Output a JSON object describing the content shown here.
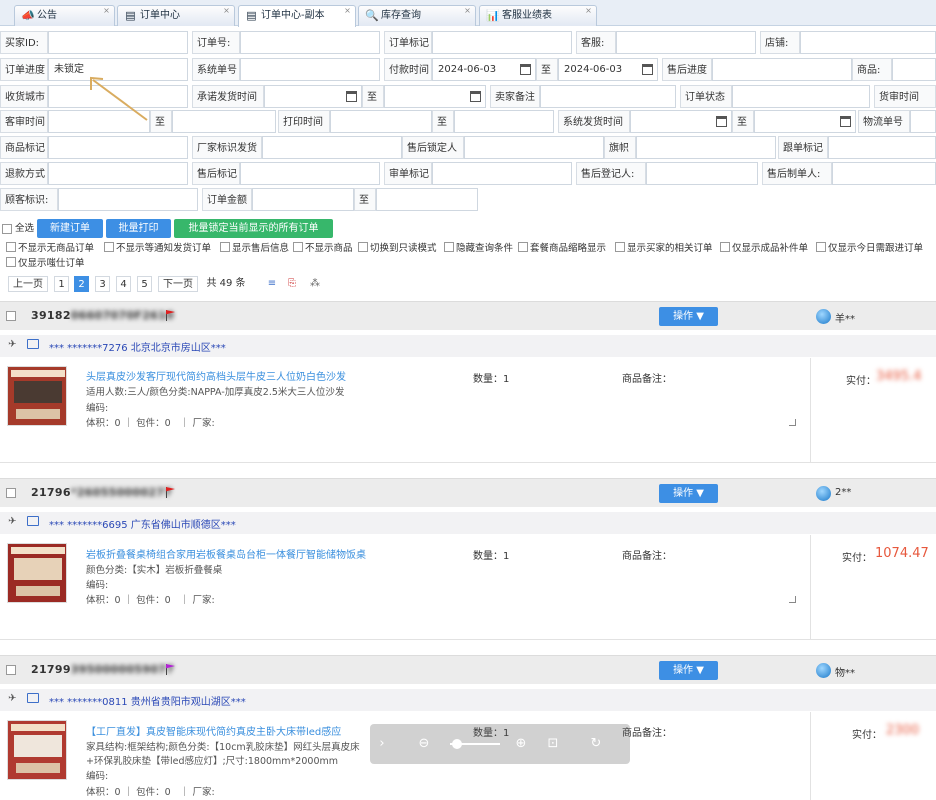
{
  "tabs": [
    {
      "label": "公告",
      "icon": "bullhorn-icon",
      "glyph": "📣"
    },
    {
      "label": "订单中心",
      "icon": "order-icon",
      "glyph": "▤"
    },
    {
      "label": "订单中心-副本",
      "icon": "order-icon",
      "glyph": "▤"
    },
    {
      "label": "库存查询",
      "icon": "search-icon",
      "glyph": "🔍"
    },
    {
      "label": "客服业绩表",
      "icon": "chart-icon",
      "glyph": "📊"
    }
  ],
  "filters": {
    "buyer_id": "买家ID:",
    "order_no": "订单号:",
    "order_tag": "订单标记",
    "cs": "客服:",
    "shop": "店铺:",
    "progress": "订单进度",
    "progress_value": "未锁定",
    "sys_no": "系统单号",
    "pay_time": "付款时间",
    "pay_from": "2024-06-03",
    "to": "至",
    "pay_to": "2024-06-03",
    "after_progress": "售后进度",
    "goods": "商品:",
    "recv_city": "收货城市",
    "promise_time": "承诺发货时间",
    "seller_note": "卖家备注",
    "order_state": "订单状态",
    "stock_time": "货审时间",
    "audit_time": "客审时间",
    "print_time": "打印时间",
    "ship_time": "系统发货时间",
    "logistics_no": "物流单号",
    "goods_tag": "商品标记",
    "factory_tag": "厂家标识发货",
    "after_lock": "售后锁定人",
    "flag": "旗帜",
    "follow_tag": "跟单标记",
    "refund_way": "退款方式",
    "after_tag": "售后标记",
    "audit_tag": "审单标记",
    "after_reg": "售后登记人:",
    "after_maker": "售后制单人:",
    "customer_tag": "顾客标识:",
    "order_amount": "订单金额"
  },
  "actions": {
    "select_all": "全选",
    "new_order": "新建订单",
    "batch_print": "批量打印",
    "batch_lock": "批量锁定当前显示的所有订单"
  },
  "options": [
    "不显示无商品订单",
    "不显示等通知发货订单",
    "显示售后信息",
    "不显示商品",
    "切换到只读模式",
    "隐藏查询条件",
    "套餐商品缩略显示",
    "显示买家的相关订单",
    "仅显示成品补件单",
    "仅显示今日需跟进订单",
    "仅显示嗤仕订单"
  ],
  "pager": {
    "prev": "上一页",
    "pages": [
      "1",
      "2",
      "3",
      "4",
      "5"
    ],
    "current": "2",
    "next": "下一页",
    "total": "共 49 条"
  },
  "orders": [
    {
      "id": "39182",
      "id_tail": "06607070F2610",
      "flag_color": "#e02020",
      "buyer": "羊**",
      "addr": "*** *******7276 北京北京市房山区***",
      "title": "头层真皮沙发客厅现代简约高档头层牛皮三人位奶白色沙发",
      "line1": "适用人数:三人/颜色分类:NAPPA-加厚真皮2.5米大三人位沙发",
      "code": "编码:",
      "volume": "体积：0 ｜ 包件：0",
      "factory": "｜ 厂家:",
      "qty": "数量：1",
      "note": "商品备注：",
      "paid": "实付：",
      "amount": "3495.4"
    },
    {
      "id": "21796",
      "id_tail": "*260550000277",
      "flag_color": "#e02020",
      "buyer": "2**",
      "addr": "*** *******6695 广东省佛山市顺德区***",
      "title": "岩板折叠餐桌椅组合家用岩板餐桌岛台柜一体餐厅智能储物饭桌",
      "line1": "颜色分类:【实木】岩板折叠餐桌",
      "code": "编码:",
      "volume": "体积：0 ｜ 包件：0",
      "factory": "｜ 厂家:",
      "qty": "数量：1",
      "note": "商品备注：",
      "paid": "实付：",
      "amount": "1074.47"
    },
    {
      "id": "21799",
      "id_tail": "3950000059077",
      "flag_color": "#b321d6",
      "buyer": "物**",
      "addr": "*** *******0811 贵州省贵阳市观山湖区***",
      "title": "【工厂直发】真皮智能床现代简约真皮主卧大床带led感应",
      "line1": "家具结构:框架结构;颜色分类:【10cm乳胶床垫】网红头层真皮床",
      "line2": "+环保乳胶床垫【带led感应灯】;尺寸:1800mm*2000mm",
      "code": "编码:",
      "volume": "体积：0 ｜ 包件：0",
      "factory": "｜ 厂家:",
      "qty": "数量：1",
      "note": "商品备注：",
      "paid": "实付：",
      "amount": "2300"
    }
  ],
  "op_label": "操作 ▼",
  "colors": {
    "accent": "#3d8fe4",
    "green": "#37b76b",
    "price": "#e7583d",
    "link": "#2a48b6"
  }
}
